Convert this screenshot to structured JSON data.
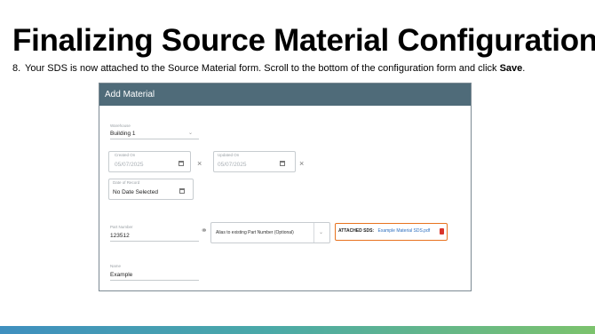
{
  "slide": {
    "title": "Finalizing Source Material Configuration",
    "step_number": "8.",
    "instruction_text": "Your SDS is now attached to the Source Material form. Scroll to the bottom of the configuration form and click ",
    "instruction_bold": "Save",
    "instruction_end": "."
  },
  "dialog": {
    "title": "Add Material",
    "location": {
      "label": "Warehouse",
      "value": "Building 1"
    },
    "created_on": {
      "label": "Created On",
      "value": "05/07/2025"
    },
    "updated_on": {
      "label": "Updated On",
      "value": "05/07/2025"
    },
    "date_of_record": {
      "label": "Date of Record",
      "value": "No Date Selected"
    },
    "part_number": {
      "label": "Part Number",
      "value": "123512"
    },
    "link_part": {
      "placeholder": "Alias to existing Part Number (Optional)"
    },
    "attached_sds": {
      "label": "ATTACHED SDS:",
      "file": "Example Material SDS.pdf"
    },
    "name": {
      "label": "Name",
      "value": "Example"
    }
  },
  "colors": {
    "header": "#4f6b79",
    "highlight": "#e8731f",
    "link": "#2d6fbf",
    "trash": "#d9352b"
  }
}
